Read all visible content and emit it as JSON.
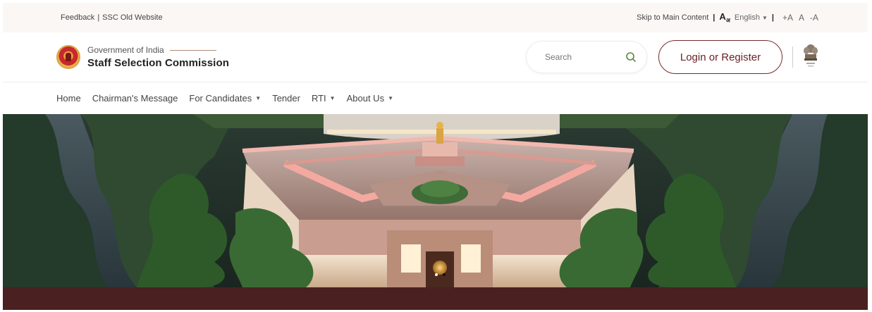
{
  "utility_bar": {
    "feedback": "Feedback",
    "separator": "|",
    "old_site": "SSC Old Website",
    "skip": "Skip to Main Content",
    "lang_icon_main": "A",
    "lang_icon_sub": "अ",
    "language": "English",
    "font_increase": "+A",
    "font_normal": "A",
    "font_decrease": "-A"
  },
  "header": {
    "gov_label": "Government of India",
    "org_name": "Staff Selection Commission",
    "search_placeholder": "Search",
    "login_label": "Login or Register"
  },
  "nav": {
    "items": [
      {
        "label": "Home",
        "has_dropdown": false
      },
      {
        "label": "Chairman's Message",
        "has_dropdown": false
      },
      {
        "label": "For Candidates",
        "has_dropdown": true
      },
      {
        "label": "Tender",
        "has_dropdown": false
      },
      {
        "label": "RTI",
        "has_dropdown": true
      },
      {
        "label": "About Us",
        "has_dropdown": true
      }
    ]
  },
  "hero": {
    "subject": "parliament-building-night-render"
  },
  "icons": {
    "search": "search-icon",
    "dropdown": "chevron-down-icon",
    "logo": "ssc-logo-icon",
    "national_emblem": "national-emblem-icon"
  },
  "colors": {
    "accent": "#6b1f23",
    "utility_bg": "#fbf7f5",
    "footer_strip": "#4a2020",
    "search_icon": "#5a8a3a"
  }
}
